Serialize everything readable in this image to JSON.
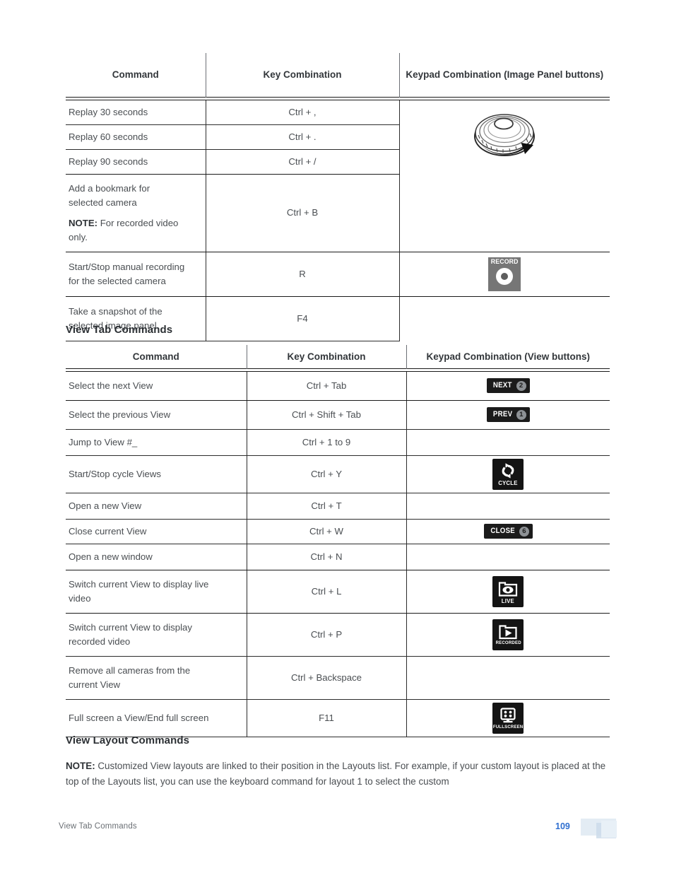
{
  "document": {
    "footer_left": "View Tab Commands",
    "page_number": "109"
  },
  "table_image_panel": {
    "headers": {
      "command": "Command",
      "key_combination": "Key Combination",
      "keypad": "Keypad Combination (Image Panel buttons)"
    },
    "rows": [
      {
        "command": "Replay 30 seconds",
        "key": "Ctrl + ,",
        "keypad": "jog-dial-icon"
      },
      {
        "command": "Replay 60 seconds",
        "key": "Ctrl + .",
        "keypad": ""
      },
      {
        "command": "Replay 90 seconds",
        "key": "Ctrl + /",
        "keypad": ""
      },
      {
        "command": "Add a bookmark for selected camera",
        "command_line1": "Add a bookmark for",
        "command_line2": "selected camera",
        "note_label": "NOTE:",
        "note_text": " For recorded video only.",
        "key": "Ctrl + B",
        "keypad": ""
      },
      {
        "command": "Start/Stop manual recording for the selected camera",
        "command_line1": "Start/Stop manual recording",
        "command_line2": " for the selected camera",
        "key": "R",
        "keypad": "record-button-icon",
        "keypad_label": "RECORD"
      },
      {
        "command": "Take a snapshot of the selected image panel",
        "command_line1": "Take a snapshot of the",
        "command_line2": "selected image panel",
        "key": "F4",
        "keypad": ""
      }
    ]
  },
  "section_view_tab": {
    "heading": "View Tab Commands",
    "headers": {
      "command": "Command",
      "key_combination": "Key Combination",
      "keypad": "Keypad Combination (View buttons)"
    },
    "rows": [
      {
        "command": "Select the next View",
        "key": "Ctrl + Tab",
        "keypad": "next-button-icon",
        "keypad_label": "NEXT",
        "keypad_number": "2"
      },
      {
        "command": "Select the previous View",
        "key": "Ctrl + Shift + Tab",
        "keypad": "prev-button-icon",
        "keypad_label": "PREV",
        "keypad_number": "1"
      },
      {
        "command": "Jump to View #_",
        "key": "Ctrl + 1 to 9",
        "keypad": ""
      },
      {
        "command": "Start/Stop cycle Views",
        "key": "Ctrl + Y",
        "keypad": "cycle-button-icon",
        "keypad_label": "CYCLE"
      },
      {
        "command": "Open a new View",
        "key": "Ctrl + T",
        "keypad": ""
      },
      {
        "command": "Close current View",
        "key": "Ctrl + W",
        "keypad": "close-button-icon",
        "keypad_label": "CLOSE",
        "keypad_number": "6"
      },
      {
        "command": "Open a new window",
        "key": "Ctrl + N",
        "keypad": ""
      },
      {
        "command": "Switch current View to display live video",
        "command_line1": "Switch current View to display live",
        "command_line2": "video",
        "key": "Ctrl + L",
        "keypad": "live-button-icon",
        "keypad_label": "LIVE"
      },
      {
        "command": "Switch current View to display recorded video",
        "command_line1": "Switch current View to display",
        "command_line2": "recorded video",
        "key": "Ctrl + P",
        "keypad": "recorded-button-icon",
        "keypad_label": "RECORDED"
      },
      {
        "command": "Remove all cameras from the current View",
        "command_line1": "Remove all cameras from the",
        "command_line2": "current View",
        "key": "Ctrl + Backspace",
        "keypad": ""
      },
      {
        "command": "Full screen a View/End full screen",
        "key": "F11",
        "keypad": "fullscreen-button-icon",
        "keypad_label": "FULLSCREEN"
      }
    ]
  },
  "section_view_layout": {
    "heading": "View Layout Commands",
    "note_label": "NOTE:",
    "note_text": " Customized View layouts are linked to their position in the Layouts list. For example, if your custom layout is placed at the top of the Layouts list, you can use the keyboard command for layout 1 to select the custom"
  },
  "colors": {
    "text": "#4a4e52",
    "heading": "#2b2f33",
    "rule": "#1a1a1a",
    "page_number": "#2f6fd0",
    "keypad_black": "#141414",
    "keypad_gray": "#767676"
  }
}
